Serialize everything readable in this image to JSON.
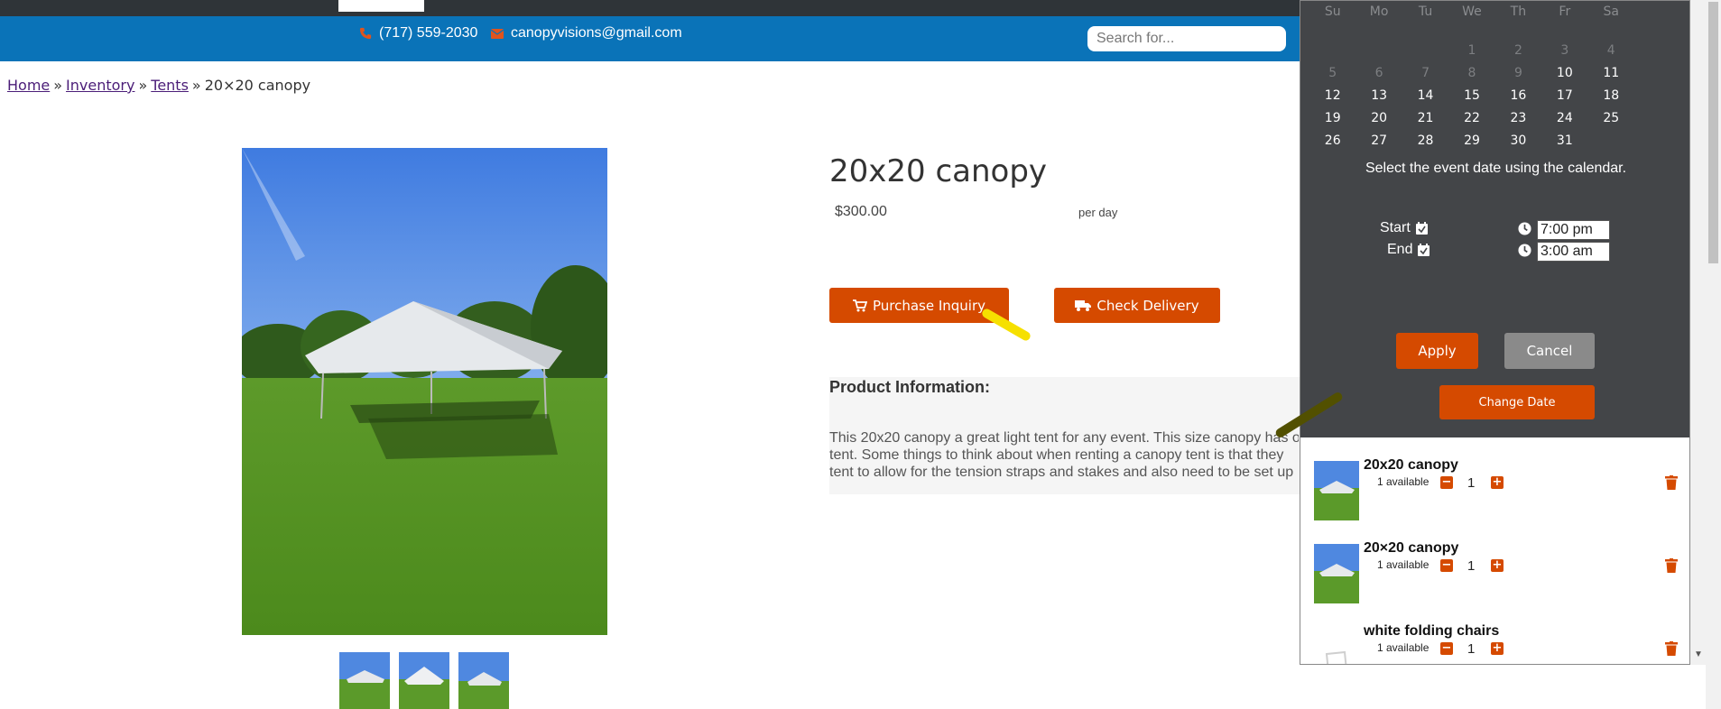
{
  "header": {
    "phone": "(717) 559-2030",
    "email": "canopyvisions@gmail.com",
    "search_placeholder": "Search for..."
  },
  "breadcrumb": {
    "items": [
      "Home",
      "Inventory",
      "Tents"
    ],
    "separator": "»",
    "current": "20×20 canopy"
  },
  "product": {
    "title": "20x20 canopy",
    "price": "$300.00",
    "price_unit": "per day",
    "purchase_inquiry": "Purchase Inquiry",
    "check_delivery": "Check Delivery",
    "info_heading": "Product Information:",
    "info_lines": [
      "This 20x20 canopy a great light tent for any event. This size canopy has o",
      "tent.  Some things to think about when renting a canopy tent is that they",
      "tent to allow for the tension straps and stakes and also need to be set up"
    ]
  },
  "calendar": {
    "weekdays": [
      "Su",
      "Mo",
      "Tu",
      "We",
      "Th",
      "Fr",
      "Sa"
    ],
    "weeks": [
      [
        "",
        "",
        "",
        "1",
        "2",
        "3",
        "4"
      ],
      [
        "5",
        "6",
        "7",
        "8",
        "9",
        "10",
        "11"
      ],
      [
        "12",
        "13",
        "14",
        "15",
        "16",
        "17",
        "18"
      ],
      [
        "19",
        "20",
        "21",
        "22",
        "23",
        "24",
        "25"
      ],
      [
        "26",
        "27",
        "28",
        "29",
        "30",
        "31",
        ""
      ]
    ],
    "disabled_days": [
      "1",
      "2",
      "3",
      "4",
      "5",
      "6",
      "7",
      "8",
      "9"
    ],
    "message": "Select the event date using the calendar.",
    "start_label": "Start",
    "end_label": "End",
    "start_time": "7:00 pm",
    "end_time": "3:00 am",
    "apply": "Apply",
    "cancel": "Cancel",
    "change_date": "Change Date"
  },
  "cart": {
    "items": [
      {
        "name": "20x20 canopy",
        "availability": "1 available",
        "quantity": "1",
        "icon": "tent-thumbnail"
      },
      {
        "name": "20×20 canopy",
        "availability": "1 available",
        "quantity": "1",
        "icon": "tent-thumbnail"
      },
      {
        "name": "white folding chairs",
        "availability": "1 available",
        "quantity": "1",
        "icon": "chair-thumbnail"
      }
    ]
  },
  "colors": {
    "accent": "#d54a00",
    "header_blue": "#0a73b8",
    "panel_dark": "#434548"
  }
}
